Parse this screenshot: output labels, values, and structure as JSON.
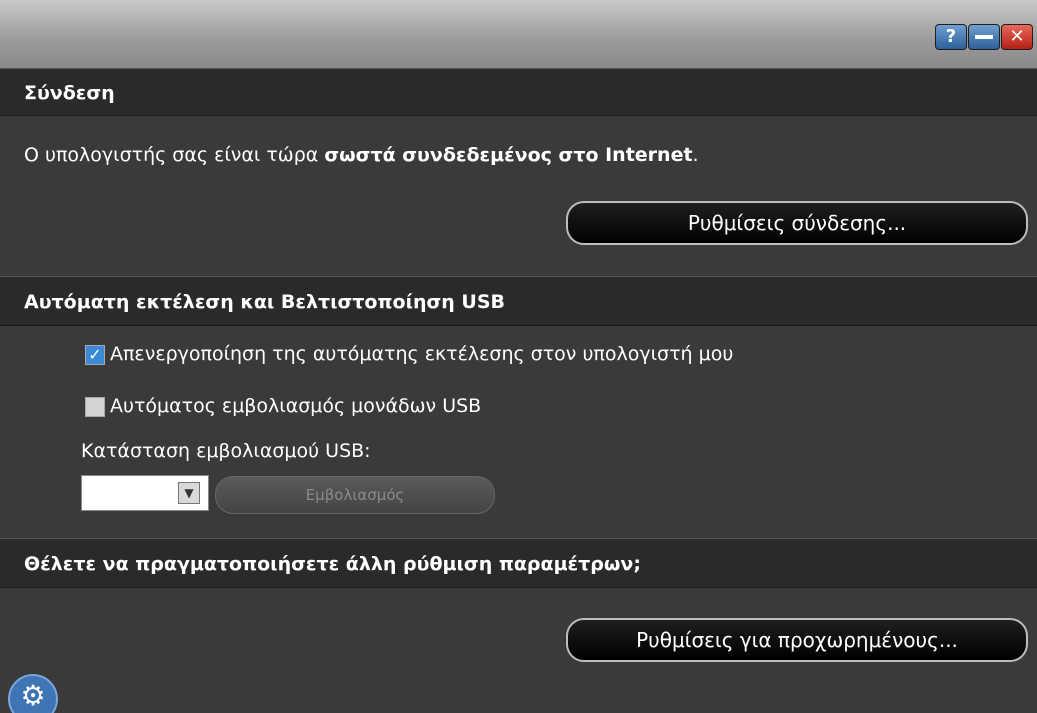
{
  "titlebar": {
    "help_icon": "help-icon",
    "minimize_icon": "minimize-icon",
    "close_icon": "close-icon",
    "help_glyph": "?",
    "close_glyph": "✕"
  },
  "connection": {
    "header": "Σύνδεση",
    "status_prefix": "Ο υπολογιστής σας είναι τώρα ",
    "status_bold": "σωστά συνδεδεμένος στο Internet",
    "status_suffix": ".",
    "settings_button": "Ρυθμίσεις σύνδεσης..."
  },
  "usb": {
    "header": "Αυτόματη εκτέλεση και Βελτιστοποίηση USB",
    "disable_autorun_label": "Απενεργοποίηση της αυτόματης εκτέλεσης στον υπολογιστή μου",
    "disable_autorun_checked": true,
    "auto_vaccinate_label": "Αυτόματος εμβολιασμός μονάδων USB",
    "auto_vaccinate_checked": false,
    "vaccination_status_label": "Κατάσταση εμβολιασμού USB:",
    "vaccination_select_value": "",
    "vaccinate_button": "Εμβολιασμός"
  },
  "advanced": {
    "header": "Θέλετε να πραγματοποιήσετε άλλη ρύθμιση παραμέτρων;",
    "settings_button": "Ρυθμίσεις για προχωρημένους..."
  },
  "footer": {
    "settings_icon": "gear-icon",
    "gear_glyph": "⚙"
  },
  "colors": {
    "check_accent": "#3c8ad6",
    "close_red": "#c8281c",
    "help_blue": "#3d72b0"
  }
}
